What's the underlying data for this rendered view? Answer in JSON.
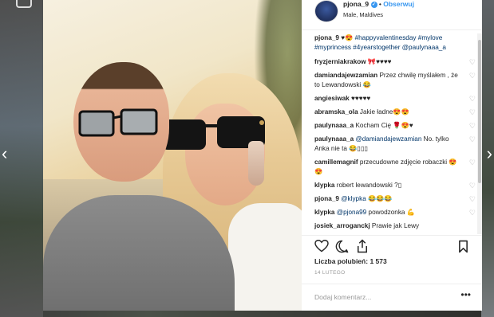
{
  "nav": {
    "prev_icon": "‹",
    "next_icon": "›"
  },
  "post": {
    "username": "pjona_9",
    "separator": "•",
    "follow_label": "Obserwuj",
    "location": "Male, Maldives",
    "caption": {
      "username": "pjona_9",
      "emoji": "♥😍",
      "hashtags": [
        "#happyvalentinesday",
        "#mylove",
        "#myprincess",
        "#4yearstogether"
      ],
      "mention": "@paulynaaa_a"
    },
    "comments": [
      {
        "user": "fryzjerniakrakow",
        "text": "🎀♥♥♥♥"
      },
      {
        "user": "damiandajewzamian",
        "text": "Przez chwilę myślałem , że to Lewandowski 😂"
      },
      {
        "user": "angiesiwak",
        "text": "♥♥♥♥♥"
      },
      {
        "user": "abramska_ola",
        "text": "Jakie ładne😍😍"
      },
      {
        "user": "paulynaaa_a",
        "text": "Kocham Cię 🌹😍♥"
      },
      {
        "user": "paulynaaa_a",
        "mention": "@damiandajewzamian",
        "text": "No. tylko Anka nie ta 😂▯▯▯"
      },
      {
        "user": "camillemagnif",
        "text": "przecudowne zdjęcie robaczki 😍😍"
      },
      {
        "user": "klypka",
        "text": "robert lewandowski ?▯"
      },
      {
        "user": "pjona_9",
        "mention": "@klypka",
        "text": "😂😂😂"
      },
      {
        "user": "klypka",
        "mention": "@pjona99",
        "text": "powodzonka 💪"
      },
      {
        "user": "josiek_arroganckj",
        "text": "Prawie jak Lewy"
      }
    ],
    "likes_label": "Liczba polubień:",
    "likes_count": "1 573",
    "date": "14 LUTEGO",
    "add_comment_placeholder": "Dodaj komentarz...",
    "more_icon": "•••"
  },
  "icons": [
    "heart-icon",
    "comment-icon",
    "share-icon",
    "bookmark-icon",
    "verified-icon"
  ],
  "colors": {
    "link": "#3897f0",
    "hashtag": "#003569",
    "text": "#262626",
    "muted": "#999999"
  }
}
